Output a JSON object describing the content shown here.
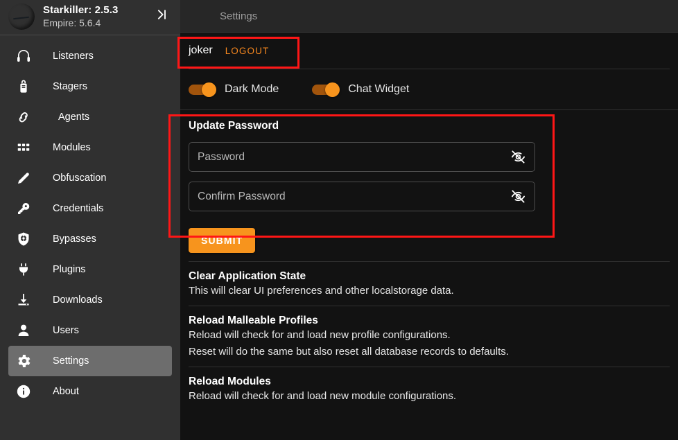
{
  "sidebar": {
    "avatar_icon": "starkiller-logo-avatar",
    "app_title": "Starkiller: 2.5.3",
    "app_subtitle": "Empire: 5.6.4",
    "collapse_icon": "menu-collapse-icon",
    "items": [
      {
        "label": "Listeners",
        "icon": "headphones-icon",
        "active": false
      },
      {
        "label": "Stagers",
        "icon": "briefcase-lock-icon",
        "active": false
      },
      {
        "label": "Agents",
        "icon": "link-chain-icon",
        "active": false
      },
      {
        "label": "Modules",
        "icon": "grid-dots-icon",
        "active": false
      },
      {
        "label": "Obfuscation",
        "icon": "pencil-icon",
        "active": false
      },
      {
        "label": "Credentials",
        "icon": "key-icon",
        "active": false
      },
      {
        "label": "Bypasses",
        "icon": "shield-gear-icon",
        "active": false
      },
      {
        "label": "Plugins",
        "icon": "power-plug-icon",
        "active": false
      },
      {
        "label": "Downloads",
        "icon": "download-icon",
        "active": false
      },
      {
        "label": "Users",
        "icon": "person-icon",
        "active": false
      },
      {
        "label": "Settings",
        "icon": "gear-icon",
        "active": true
      },
      {
        "label": "About",
        "icon": "info-circle-icon",
        "active": false
      }
    ]
  },
  "topbar": {
    "title": "Settings"
  },
  "account": {
    "username": "joker",
    "logout_label": "LOGOUT"
  },
  "toggles": [
    {
      "label": "Dark Mode",
      "on": true
    },
    {
      "label": "Chat Widget",
      "on": true
    }
  ],
  "update_password": {
    "title": "Update Password",
    "password_placeholder": "Password",
    "password_value": "",
    "confirm_placeholder": "Confirm Password",
    "confirm_value": "",
    "visibility_icon": "eye-off-icon",
    "submit_label": "SUBMIT"
  },
  "blocks": [
    {
      "title": "Clear Application State",
      "lines": [
        "This will clear UI preferences and other localstorage data."
      ]
    },
    {
      "title": "Reload Malleable Profiles",
      "lines": [
        "Reload will check for and load new profile configurations.",
        "Reset will do the same but also reset all database records to defaults."
      ]
    },
    {
      "title": "Reload Modules",
      "lines": [
        "Reload will check for and load new module configurations."
      ]
    }
  ],
  "colors": {
    "accent": "#f7941d",
    "annotation": "#ff1616",
    "sidebar_bg": "#303030",
    "content_bg": "#121212",
    "topbar_bg": "#272727",
    "active_item_bg": "#6d6d6d"
  }
}
